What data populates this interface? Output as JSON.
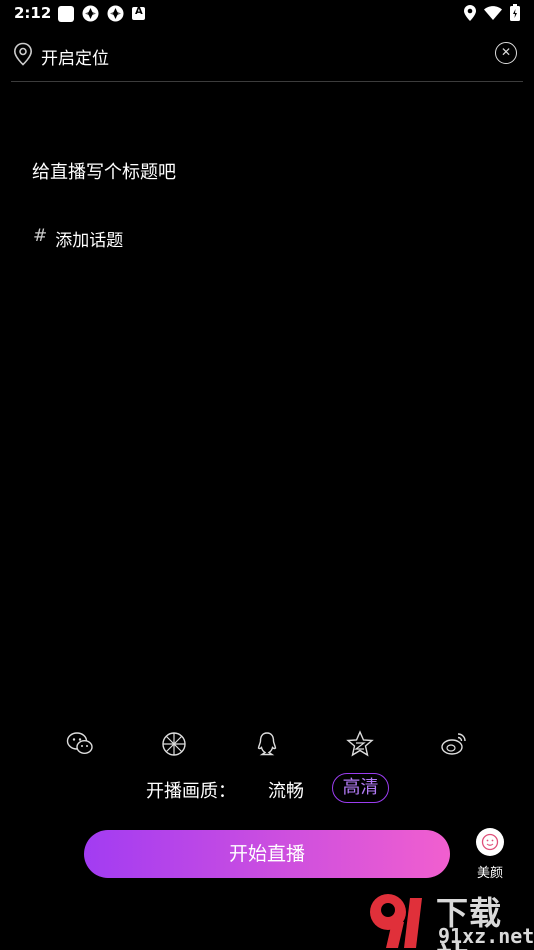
{
  "status_bar": {
    "time": "2:12",
    "icons": [
      "app-square-icon",
      "aperture-icon",
      "aperture-icon",
      "a-square-icon",
      "location-icon",
      "wifi-icon",
      "battery-icon"
    ]
  },
  "location": {
    "label": "开启定位",
    "icon": "location-pin-icon",
    "clear_icon": "close-circle-icon"
  },
  "title_placeholder": "给直播写个标题吧",
  "topic": {
    "hash": "#",
    "label": "添加话题"
  },
  "share_icons": [
    "wechat-icon",
    "moments-icon",
    "qq-icon",
    "qzone-icon",
    "weibo-icon"
  ],
  "quality": {
    "label": "开播画质：",
    "options": [
      "流畅",
      "高清"
    ],
    "selected": "高清"
  },
  "start_button": "开始直播",
  "beauty": {
    "label": "美颜"
  },
  "watermark": {
    "brand": "下载站",
    "domain": "91xz.net"
  },
  "colors": {
    "accent": "#9b3df0",
    "gradient_start": "#a23cf2",
    "gradient_end": "#f15fcf",
    "watermark_red": "#e0303a"
  }
}
